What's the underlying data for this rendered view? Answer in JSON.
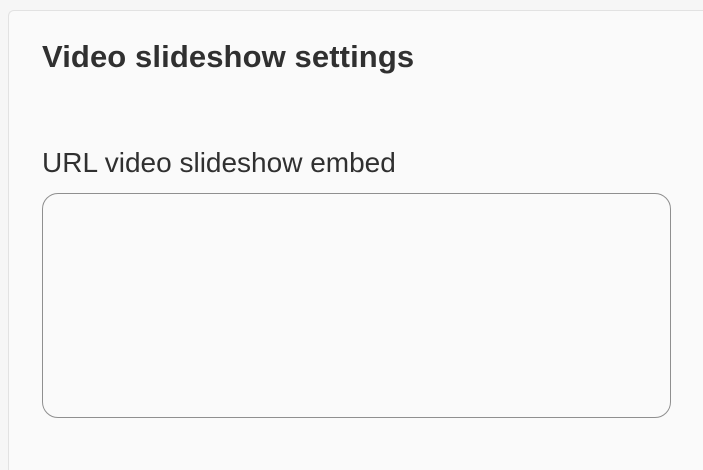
{
  "settings_panel": {
    "title": "Video slideshow settings",
    "url_field": {
      "label": "URL video slideshow embed",
      "value": "",
      "placeholder": ""
    }
  },
  "colors": {
    "panel_background": "#fafafa",
    "text": "#303030",
    "field_border": "#8f8f8f"
  }
}
